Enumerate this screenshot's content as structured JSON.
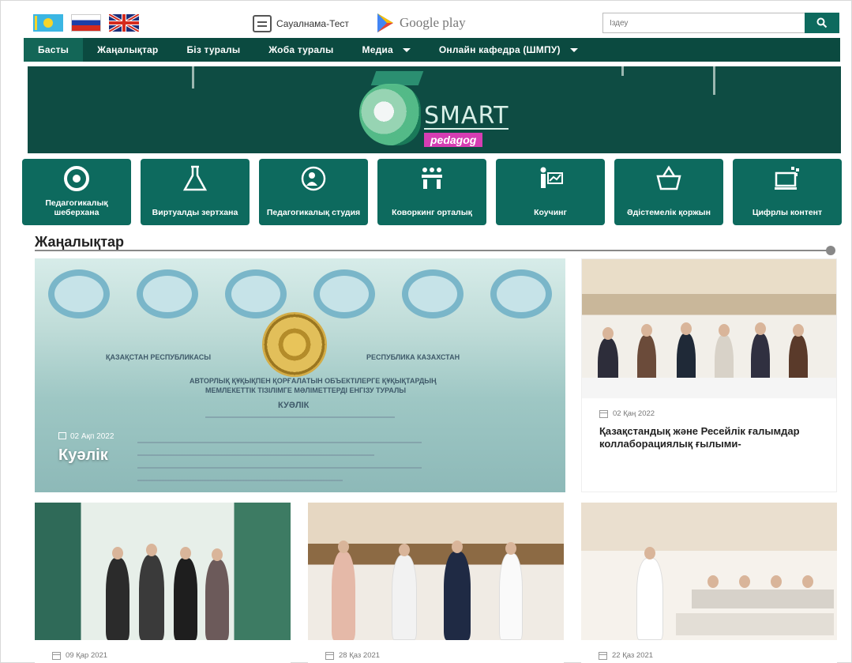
{
  "topbar": {
    "survey_label": "Сауалнама-Тест",
    "gplay_label": "Google play",
    "search_placeholder": "Іздеу",
    "search_button_icon": "search-icon"
  },
  "nav": {
    "items": [
      {
        "label": "Басты",
        "active": true
      },
      {
        "label": "Жаңалықтар"
      },
      {
        "label": "Біз туралы"
      },
      {
        "label": "Жоба туралы"
      },
      {
        "label": "Медиа",
        "dropdown": true
      },
      {
        "label": "Онлайн кафедра (ШМПУ)",
        "dropdown": true
      }
    ]
  },
  "logo": {
    "text1": "SMART",
    "text2": "pedagog"
  },
  "tiles": [
    {
      "label": "Педагогикалық шеберхана",
      "icon": "gear-icon"
    },
    {
      "label": "Виртуалды зертхана",
      "icon": "flask-icon"
    },
    {
      "label": "Педагогикалық студия",
      "icon": "studio-icon"
    },
    {
      "label": "Коворкинг орталық",
      "icon": "coworking-icon"
    },
    {
      "label": "Коучинг",
      "icon": "coaching-icon"
    },
    {
      "label": "Әдістемелік қоржын",
      "icon": "basket-icon"
    },
    {
      "label": "Цифрлы контент",
      "icon": "digital-icon"
    }
  ],
  "news": {
    "section_title": "Жаңалықтар",
    "feature": {
      "date": "02 Ақп 2022",
      "title": "Куәлік",
      "doc_left": "ҚАЗАҚСТАН РЕСПУБЛИКАСЫ",
      "doc_right": "РЕСПУБЛИКА КАЗАХСТАН",
      "doc_line1": "АВТОРЛЫҚ ҚҰҚЫҚПЕН ҚОРҒАЛАТЫН ОБЪЕКТІЛЕРГЕ ҚҰҚЫҚТАРДЫҢ",
      "doc_line2": "МЕМЛЕКЕТТІК ТІЗІЛІМГЕ МӘЛІМЕТТЕРДІ ЕНГІЗУ ТУРАЛЫ",
      "doc_line3": "КУӘЛІК"
    },
    "side": {
      "date": "02 Қаң 2022",
      "title": "Қазақстандық және Ресейлік ғалымдар коллаборациялық ғылыми-"
    },
    "cards": [
      {
        "date": "09 Қар 2021"
      },
      {
        "date": "28 Қаз 2021"
      },
      {
        "date": "22 Қаз 2021"
      }
    ]
  }
}
